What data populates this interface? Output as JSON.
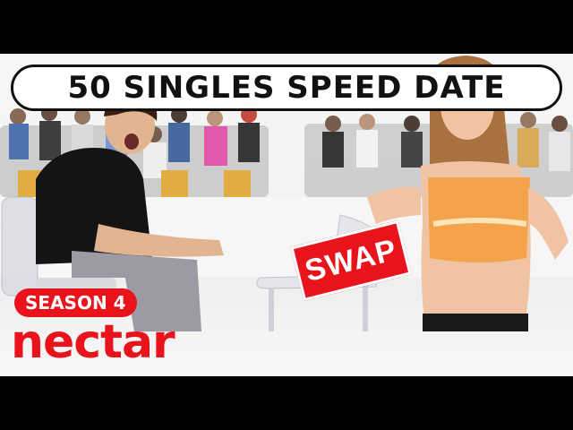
{
  "thumbnail": {
    "title": "50 SINGLES SPEED DATE",
    "badge_label": "SEASON 4",
    "sign_text": "SWAP",
    "logo_text": "nectar"
  },
  "colors": {
    "accent_red": "#e8131b",
    "title_border": "#111111",
    "background": "#f4f4f4",
    "letterbox": "#000000"
  },
  "icons": [
    "swap-sign",
    "nectar-logo"
  ]
}
